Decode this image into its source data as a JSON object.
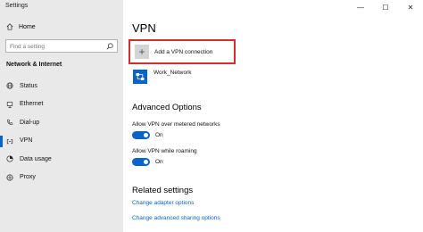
{
  "window": {
    "title": "Settings",
    "minimize": "—",
    "maximize": "☐",
    "close": "✕"
  },
  "sidebar": {
    "home_label": "Home",
    "search_placeholder": "Find a setting",
    "section_title": "Network & Internet",
    "items": [
      {
        "label": "Status",
        "icon": "globe-icon"
      },
      {
        "label": "Ethernet",
        "icon": "ethernet-icon"
      },
      {
        "label": "Dial-up",
        "icon": "phone-icon"
      },
      {
        "label": "VPN",
        "icon": "vpn-icon",
        "selected": true
      },
      {
        "label": "Data usage",
        "icon": "data-usage-icon"
      },
      {
        "label": "Proxy",
        "icon": "proxy-icon"
      }
    ]
  },
  "main": {
    "title": "VPN",
    "add_vpn_label": "Add a VPN connection",
    "add_icon": "+",
    "vpn_connection_name": "Work_Network",
    "advanced_title": "Advanced Options",
    "metered_label": "Allow VPN over metered networks",
    "metered_state": "On",
    "roaming_label": "Allow VPN while roaming",
    "roaming_state": "On",
    "related_title": "Related settings",
    "link_adapter": "Change adapter options",
    "link_sharing": "Change advanced sharing options"
  },
  "colors": {
    "accent": "#0a64c8",
    "highlight_border": "#d32f2f",
    "sidebar_bg": "#e9e9e9"
  }
}
